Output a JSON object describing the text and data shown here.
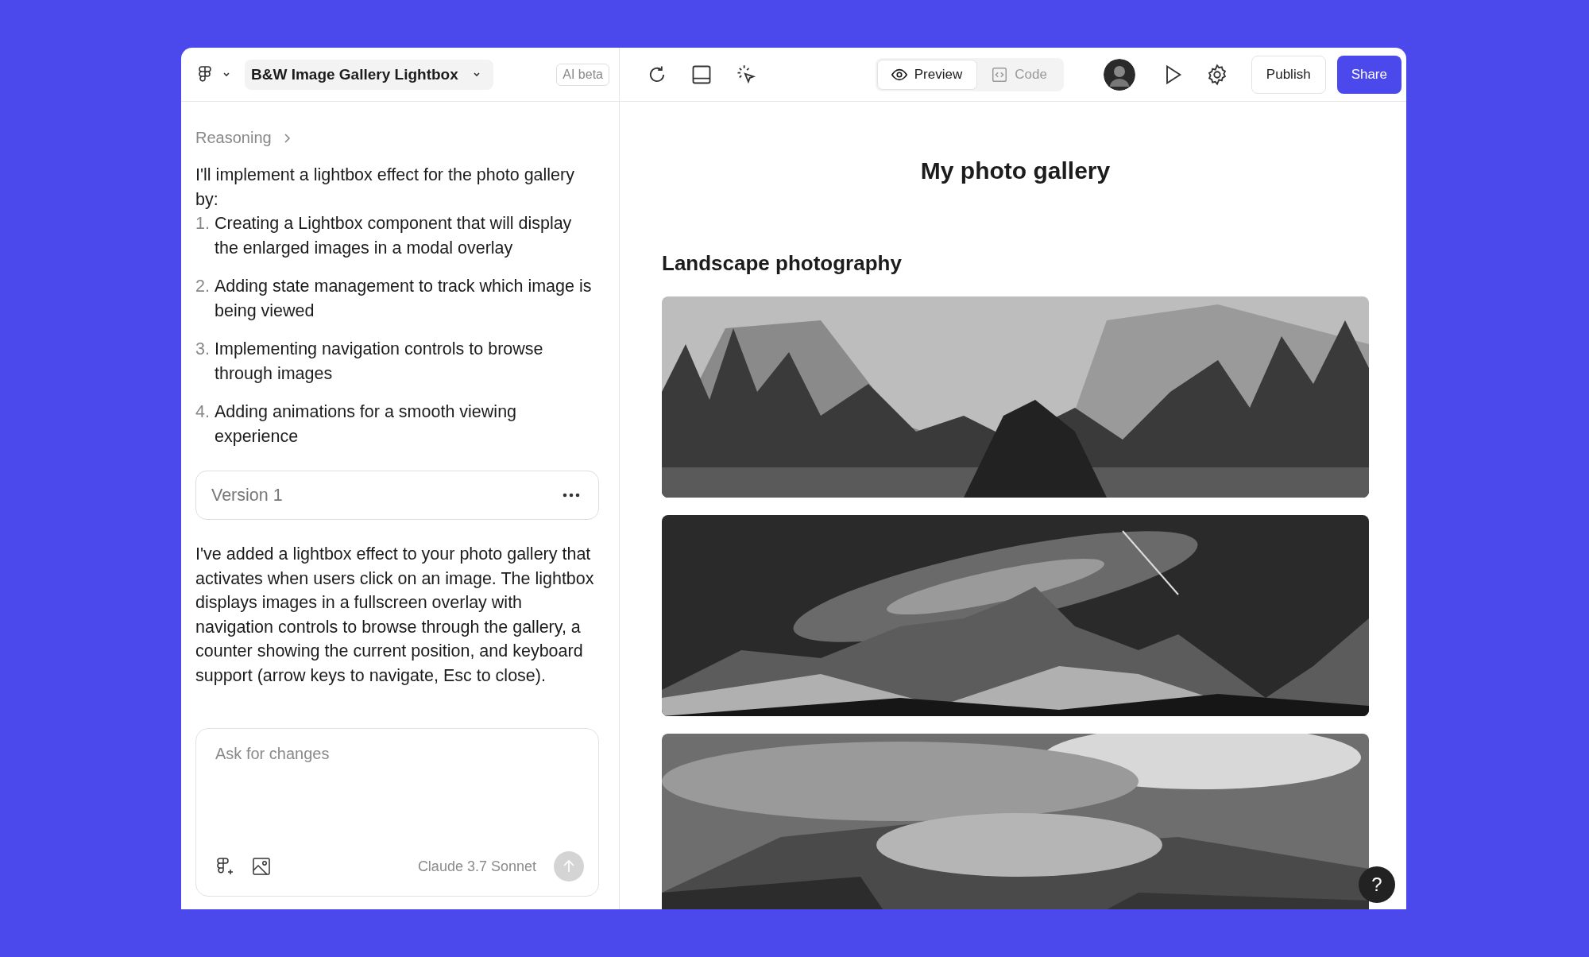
{
  "window": {
    "title": "B&W Image Gallery Lightbox"
  },
  "toolbar": {
    "badge": "AI beta",
    "tabs": [
      {
        "label": "Preview",
        "selected": true
      },
      {
        "label": "Code",
        "selected": false
      }
    ],
    "publish": "Publish",
    "share": "Share"
  },
  "chat": {
    "reasoning": "Reasoning",
    "intro": "I'll implement a lightbox effect for the photo gallery by:",
    "steps": [
      {
        "number": "1.",
        "text": "Creating a Lightbox component that will display the enlarged images in a modal overlay"
      },
      {
        "number": "2.",
        "text": "Adding state management to track which image is being viewed"
      },
      {
        "number": "3.",
        "text": "Implementing navigation controls to browse through images"
      },
      {
        "number": "4.",
        "text": "Adding animations for a smooth viewing experience"
      }
    ],
    "version": "Version 1",
    "summary": "I've added a lightbox effect to your photo gallery that activates when users click on an image. The lightbox displays images in a fullscreen overlay with navigation controls to browse through the gallery, a counter showing the current position, and keyboard support (arrow keys to navigate, Esc to close).",
    "input": {
      "placeholder": "Ask for changes"
    },
    "model": "Claude 3.7 Sonnet"
  },
  "preview": {
    "heading": "My photo gallery",
    "section": "Landscape photography"
  },
  "help": "?"
}
